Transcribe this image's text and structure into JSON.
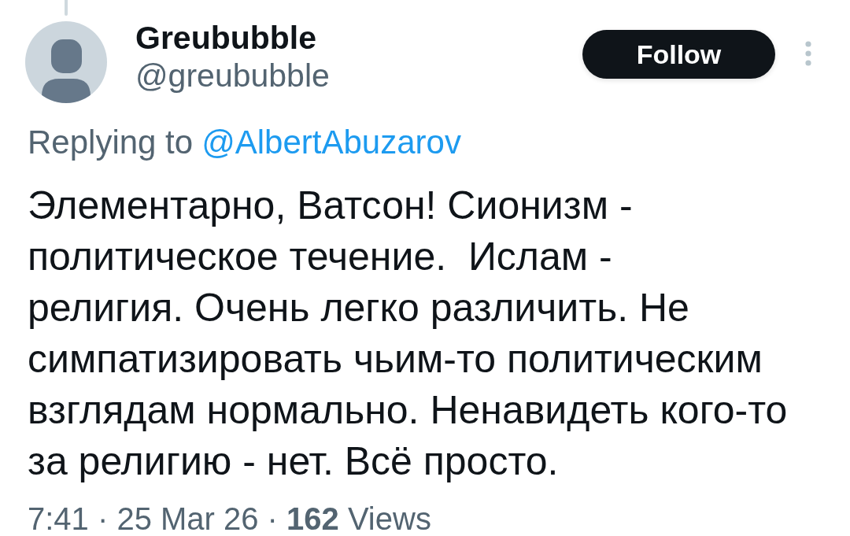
{
  "author": {
    "name": "Greububble",
    "handle": "@greububble"
  },
  "follow_button": {
    "label": "Follow"
  },
  "reply_context": {
    "label": "Replying to",
    "mention": "@AlbertAbuzarov"
  },
  "body": "Элементарно, Ватсон! Сионизм -\nполитическое течение.  Ислам -\nрелигия. Очень легко различить. Не\nсимпатизировать чьим-то политическим\nвзглядам нормально. Ненавидеть кого-то\nза религию - нет. Всё просто.",
  "meta": "7:41 · 25 Mar 26 · **162** Views"
}
